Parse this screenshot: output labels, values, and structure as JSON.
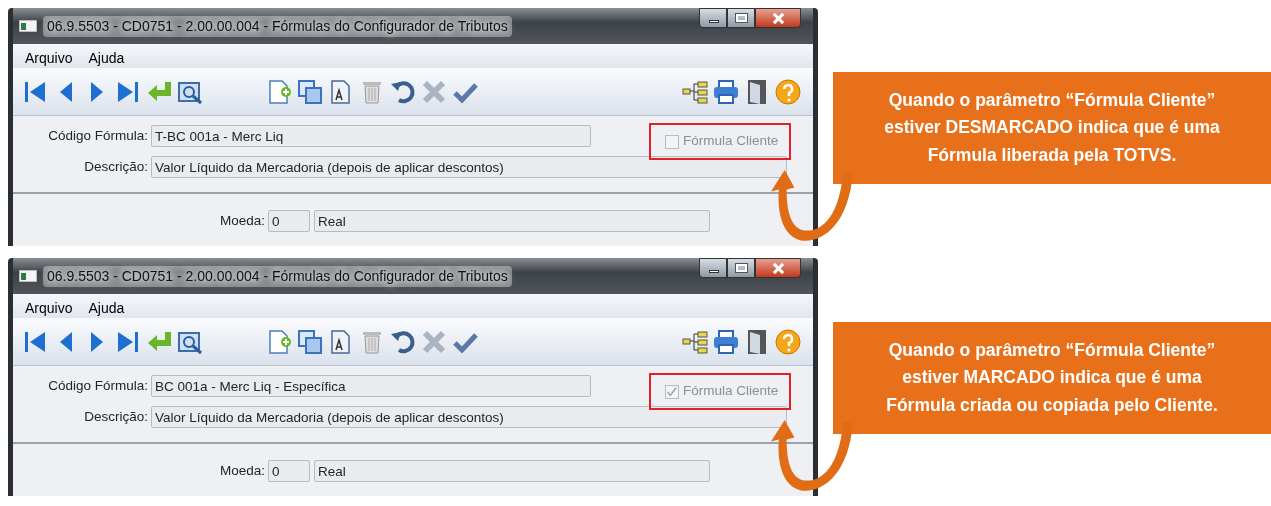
{
  "panels": [
    {
      "window": {
        "title": "06.9.5503 - CD0751 - 2.00.00.004 - Fórmulas do Configurador de Tributos"
      },
      "menu": [
        "Arquivo",
        "Ajuda"
      ],
      "form": {
        "code_label": "Código Fórmula:",
        "code_value": "T-BC 001a - Merc Liq",
        "description_label": "Descrição:",
        "description_value": "Valor Líquido da Mercadoria (depois de aplicar descontos)",
        "client_formula": {
          "label": "Fórmula Cliente",
          "checked": false
        },
        "currency_label": "Moeda:",
        "currency_code": "0",
        "currency_name": "Real"
      },
      "callout": "Quando o parâmetro “Fórmula Cliente”\nestiver DESMARCADO indica que é uma\nFórmula liberada pela TOTVS."
    },
    {
      "window": {
        "title": "06.9.5503 - CD0751 - 2.00.00.004 - Fórmulas do Configurador de Tributos"
      },
      "menu": [
        "Arquivo",
        "Ajuda"
      ],
      "form": {
        "code_label": "Código Fórmula:",
        "code_value": "BC 001a - Merc Liq - Específica",
        "description_label": "Descrição:",
        "description_value": "Valor Líquido da Mercadoria (depois de aplicar descontos)",
        "client_formula": {
          "label": "Fórmula Cliente",
          "checked": true
        },
        "currency_label": "Moeda:",
        "currency_code": "0",
        "currency_name": "Real"
      },
      "callout": "Quando o parâmetro “Fórmula Cliente”\nestiver MARCADO indica que é uma\nFórmula criada ou copiada pelo Cliente."
    }
  ]
}
